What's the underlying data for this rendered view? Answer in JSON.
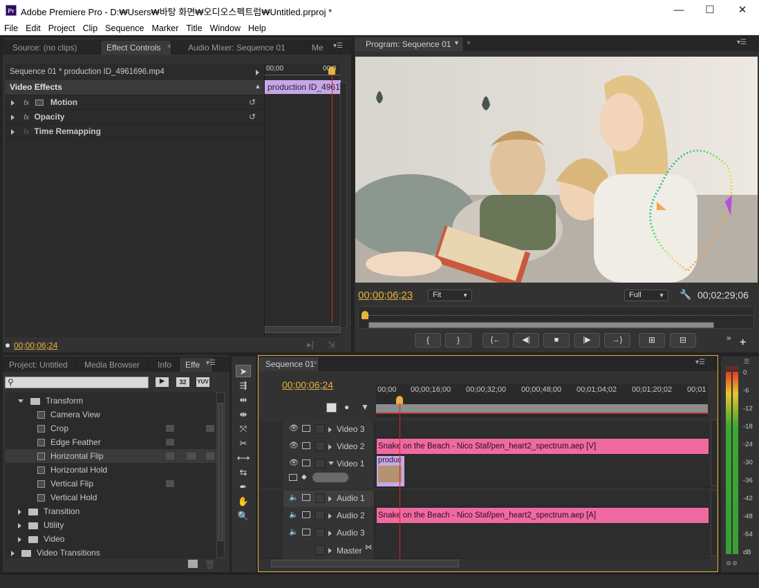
{
  "window": {
    "title": "Adobe Premiere Pro - D:₩Users₩바탕 화면₩오디오스펙트럼₩Untitled.prproj *",
    "logo": "Pr",
    "minimize": "—",
    "maximize": "☐",
    "close": "✕"
  },
  "menu": [
    "File",
    "Edit",
    "Project",
    "Clip",
    "Sequence",
    "Marker",
    "Title",
    "Window",
    "Help"
  ],
  "effect_controls": {
    "tabs": [
      "Source: (no clips)",
      "Effect Controls",
      "Audio Mixer: Sequence 01",
      "Me"
    ],
    "clip_path": "Sequence 01 * production ID_4961696.mp4",
    "ruler_start": "00;00",
    "ruler_end": "00;0",
    "clip_label": "production ID_49616",
    "section": "Video Effects",
    "effects": [
      "Motion",
      "Opacity",
      "Time Remapping"
    ],
    "timecode": "00;00;06;24"
  },
  "program": {
    "tab": "Program: Sequence 01",
    "timecode": "00;00;06;23",
    "fit": "Fit",
    "quality": "Full",
    "duration": "00;02;29;06"
  },
  "project": {
    "tabs": [
      "Project: Untitled",
      "Media Browser",
      "Info",
      "Effe"
    ],
    "badges": [
      "32",
      "YUV"
    ],
    "tree": [
      {
        "label": "Transform",
        "type": "folder-open",
        "indent": 1
      },
      {
        "label": "Camera View",
        "type": "fx",
        "indent": 2
      },
      {
        "label": "Crop",
        "type": "fx",
        "indent": 2
      },
      {
        "label": "Edge Feather",
        "type": "fx",
        "indent": 2
      },
      {
        "label": "Horizontal Flip",
        "type": "fx",
        "indent": 2
      },
      {
        "label": "Horizontal Hold",
        "type": "fx",
        "indent": 2
      },
      {
        "label": "Vertical Flip",
        "type": "fx",
        "indent": 2
      },
      {
        "label": "Vertical Hold",
        "type": "fx",
        "indent": 2
      },
      {
        "label": "Transition",
        "type": "folder",
        "indent": 1
      },
      {
        "label": "Utility",
        "type": "folder",
        "indent": 1
      },
      {
        "label": "Video",
        "type": "folder",
        "indent": 1
      },
      {
        "label": "Video Transitions",
        "type": "folder",
        "indent": 0
      }
    ]
  },
  "timeline": {
    "tab": "Sequence 01",
    "timecode": "00;00;06;24",
    "ruler": [
      "00;00",
      "00;00;16;00",
      "00;00;32;00",
      "00;00;48;00",
      "00;01;04;02",
      "00;01;20;02",
      "00;01"
    ],
    "tracks": [
      "Video 3",
      "Video 2",
      "Video 1",
      "Audio 1",
      "Audio 2",
      "Audio 3",
      "Master"
    ],
    "clip_v2": "Snake on the Beach - Nico Staf/pen_heart2_spectrum.aep [V]",
    "clip_a2": "Snake on the Beach - Nico Staf/pen_heart2_spectrum.aep [A]",
    "clip_v1": "produc"
  },
  "meter": {
    "labels": [
      "0",
      "-6",
      "-12",
      "-18",
      "-24",
      "-30",
      "-36",
      "-42",
      "-48",
      "-54",
      "dB"
    ]
  },
  "monitor_controls": [
    "{",
    "}",
    "{←",
    "◀|",
    "■",
    "|▶",
    "→}",
    "⊞",
    "⊟"
  ]
}
